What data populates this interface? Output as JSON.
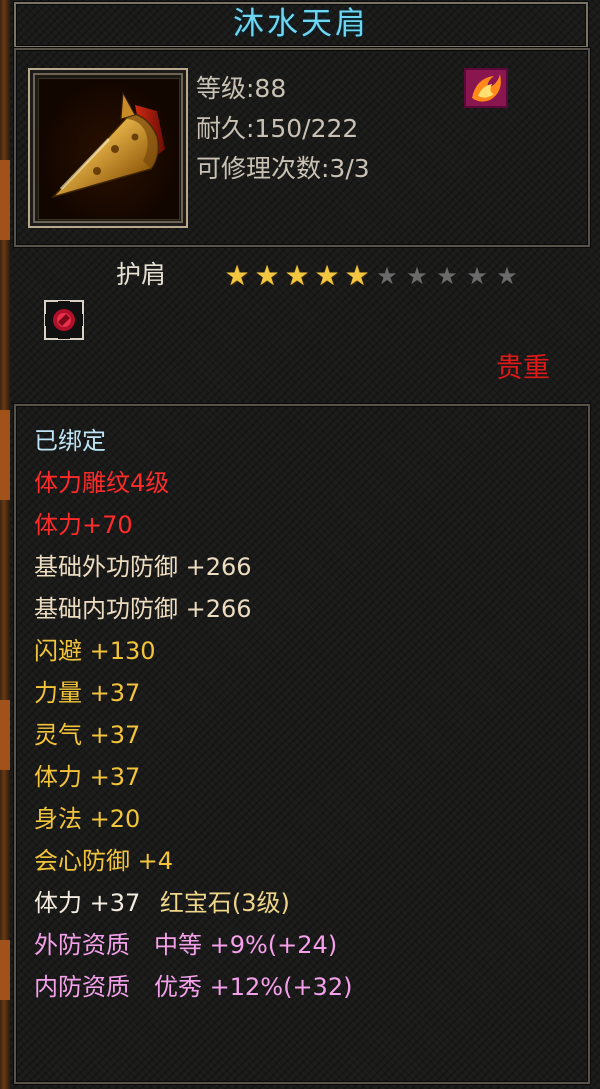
{
  "item": {
    "name": "沐水天肩",
    "level_label": "等级:88",
    "durability_label": "耐久:150/222",
    "repair_label": "可修理次数:3/3",
    "type": "护肩",
    "stars_total": 10,
    "stars_on": 5,
    "quality_label": "贵重"
  },
  "attributes": {
    "bound": "已绑定",
    "engrave": "体力雕纹4级",
    "engrave_bonus": "体力+70",
    "base_outer": "基础外功防御 +266",
    "base_inner": "基础内功防御 +266",
    "dodge": "闪避 +130",
    "strength": "力量 +37",
    "spirit": "灵气 +37",
    "stamina": "体力 +37",
    "agility": "身法 +20",
    "crit_def": "会心防御 +4",
    "gem_stat": "体力 +37",
    "gem_name": "红宝石(3级)",
    "outer_quality": "外防资质　中等 +9%(+24)",
    "inner_quality": "内防资质　优秀 +12%(+32)"
  },
  "colors": {
    "title": "#6fd6f2",
    "quality": "#e01818",
    "star_on": "#f2c640",
    "star_off": "#6a6a6a"
  },
  "icons": [
    "shoulder-armor-icon",
    "rank-emblem-icon",
    "gem-socket-icon"
  ]
}
